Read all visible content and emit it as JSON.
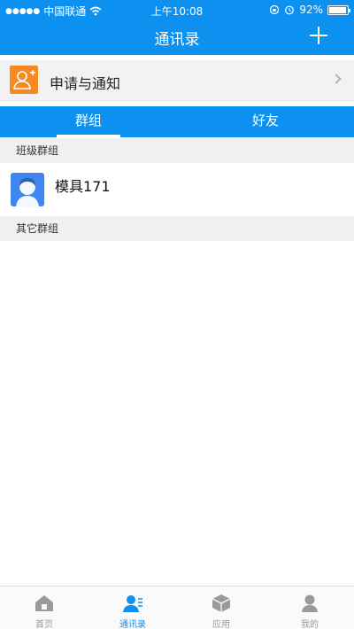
{
  "status_bar": {
    "signal_dots": "●●●●●",
    "carrier": "中国联通",
    "wifi_icon": "wifi-icon",
    "time": "上午10:08",
    "battery_percent": "92%",
    "battery_level": 0.92
  },
  "nav": {
    "title": "通讯录",
    "add_icon": "plus-icon"
  },
  "notifications": {
    "label": "申请与通知",
    "icon": "add-user-icon"
  },
  "tabs": [
    {
      "label": "群组",
      "active": true
    },
    {
      "label": "好友",
      "active": false
    }
  ],
  "sections": {
    "class_groups": "班级群组",
    "other_groups": "其它群组"
  },
  "groups": [
    {
      "name": "模具171",
      "icon": "group-avatar-icon"
    }
  ],
  "tabbar": [
    {
      "label": "首页",
      "icon": "home-icon",
      "active": false
    },
    {
      "label": "通讯录",
      "icon": "contacts-icon",
      "active": true
    },
    {
      "label": "应用",
      "icon": "apps-cube-icon",
      "active": false
    },
    {
      "label": "我的",
      "icon": "profile-icon",
      "active": false
    }
  ],
  "colors": {
    "primary": "#0d91f0",
    "notify_orange": "#f68a22",
    "avatar_blue": "#3f86f0",
    "inactive_gray": "#9a9a9a"
  }
}
